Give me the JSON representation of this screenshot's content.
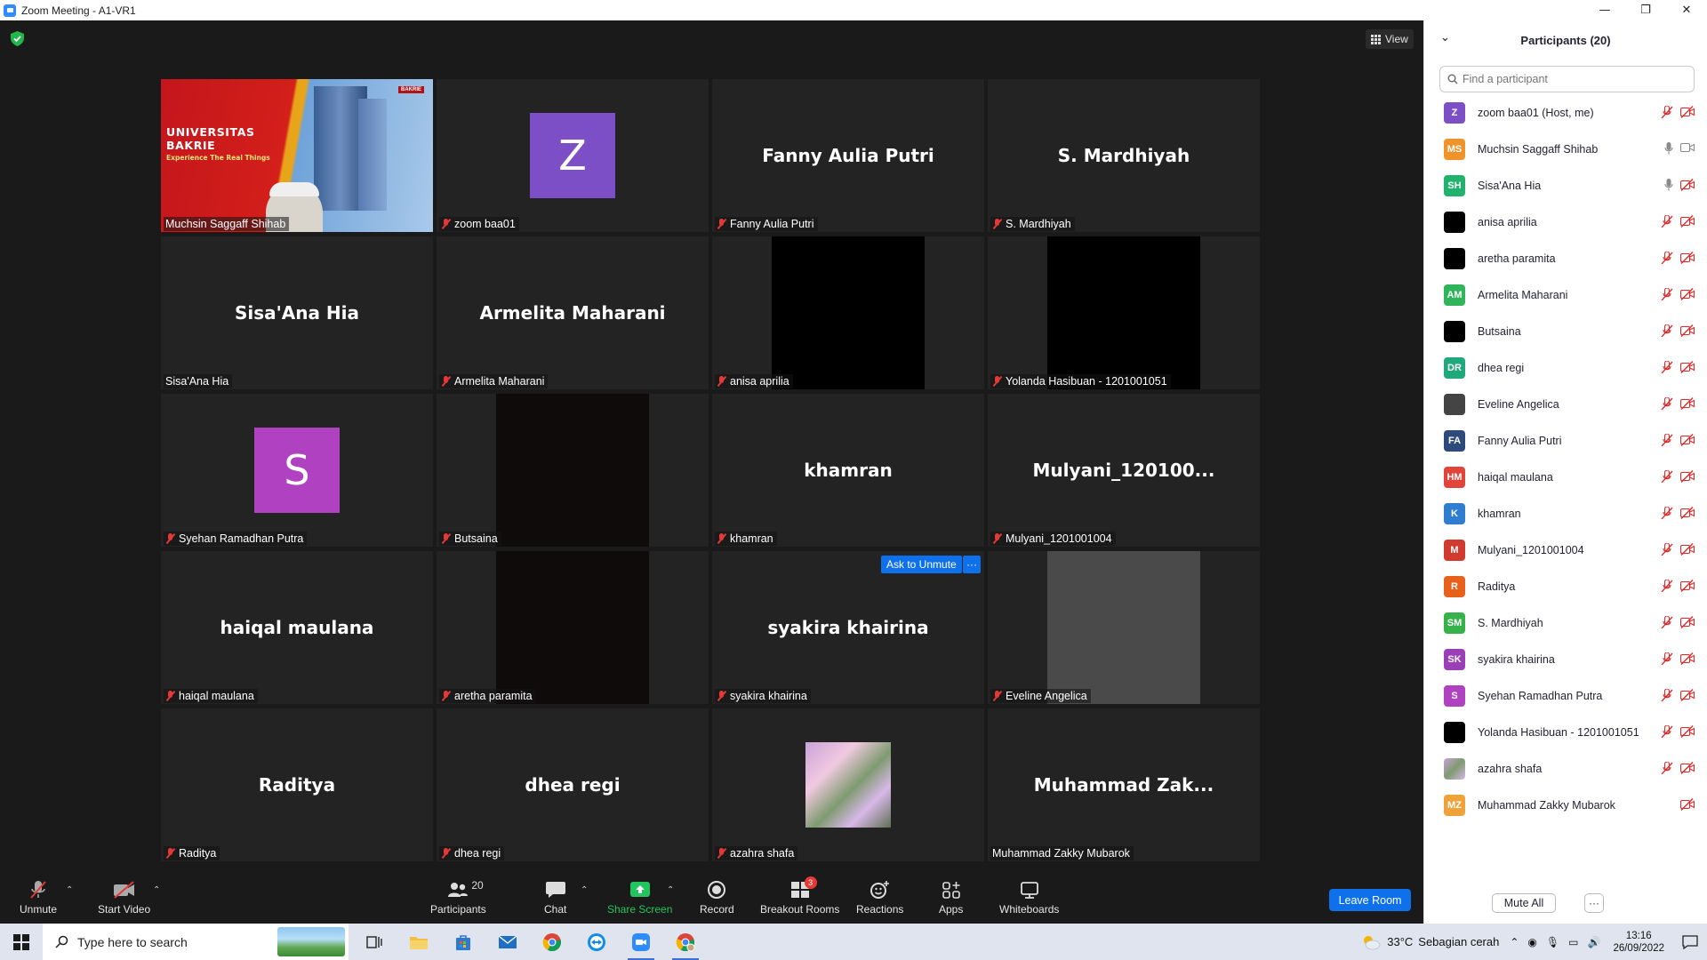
{
  "window": {
    "title": "Zoom Meeting - A1-VR1",
    "controls": [
      "—",
      "❐",
      "✕"
    ]
  },
  "meeting": {
    "view_label": "View",
    "tiles": [
      {
        "type": "video",
        "label": "Muchsin Saggaff Shihab",
        "muted": false,
        "active": true,
        "overlay": {
          "uni": "UNIVERSITAS BAKRIE",
          "tagline": "Experience The Real Things",
          "brand": "BAKRIE"
        }
      },
      {
        "type": "avatar",
        "letter": "Z",
        "color": "#7d4fc6",
        "label": "zoom baa01",
        "muted": true
      },
      {
        "type": "name",
        "display": "Fanny Aulia Putri",
        "label": "Fanny Aulia Putri",
        "muted": true
      },
      {
        "type": "name",
        "display": "S. Mardhiyah",
        "label": "S. Mardhiyah",
        "muted": true
      },
      {
        "type": "name",
        "display": "Sisa'Ana Hia",
        "label": "Sisa'Ana Hia",
        "muted": false
      },
      {
        "type": "name",
        "display": "Armelita Maharani",
        "label": "Armelita Maharani",
        "muted": true
      },
      {
        "type": "black",
        "label": "anisa aprilia",
        "muted": true
      },
      {
        "type": "black",
        "label": "Yolanda Hasibuan - 1201001051",
        "muted": true
      },
      {
        "type": "avatar",
        "letter": "S",
        "color": "#b042c2",
        "label": "Syehan Ramadhan Putra",
        "muted": true
      },
      {
        "type": "darkred",
        "label": "Butsaina",
        "muted": true
      },
      {
        "type": "name",
        "display": "khamran",
        "label": "khamran",
        "muted": true
      },
      {
        "type": "name",
        "display": "Mulyani_120100...",
        "label": "Mulyani_1201001004",
        "muted": true
      },
      {
        "type": "name",
        "display": "haiqal maulana",
        "label": "haiqal maulana",
        "muted": true
      },
      {
        "type": "darkred",
        "label": "aretha paramita",
        "muted": true
      },
      {
        "type": "name",
        "display": "syakira khairina",
        "label": "syakira khairina",
        "muted": true
      },
      {
        "type": "gray",
        "label": "Eveline Angelica",
        "muted": true
      },
      {
        "type": "name",
        "display": "Raditya",
        "label": "Raditya",
        "muted": true
      },
      {
        "type": "name",
        "display": "dhea regi",
        "label": "dhea regi",
        "muted": true
      },
      {
        "type": "photo",
        "label": "azahra shafa",
        "muted": true
      },
      {
        "type": "name",
        "display": "Muhammad  Zak...",
        "label": "Muhammad Zakky Mubarok",
        "muted": false
      }
    ],
    "ask_to_unmute": "Ask to Unmute",
    "ask_more": "···"
  },
  "toolbar": {
    "unmute": "Unmute",
    "start_video": "Start Video",
    "participants": "Participants",
    "participants_count": "20",
    "chat": "Chat",
    "share_screen": "Share Screen",
    "record": "Record",
    "breakout_rooms": "Breakout Rooms",
    "breakout_badge": "3",
    "reactions": "Reactions",
    "apps": "Apps",
    "whiteboards": "Whiteboards",
    "leave": "Leave Room",
    "caret": "⌃"
  },
  "panel": {
    "title": "Participants (20)",
    "search_placeholder": "Find a participant",
    "participants": [
      {
        "initials": "Z",
        "color": "#7d4fc6",
        "name": "zoom baa01 (Host, me)",
        "audio": "muted",
        "video": "off"
      },
      {
        "initials": "MS",
        "color": "#f0932b",
        "name": "Muchsin Saggaff Shihab",
        "audio": "on",
        "video": "on"
      },
      {
        "initials": "SH",
        "color": "#20b26c",
        "name": "Sisa'Ana Hia",
        "audio": "on",
        "video": "off"
      },
      {
        "initials": "",
        "color": "#000000",
        "name": "anisa aprilia",
        "audio": "muted",
        "video": "off"
      },
      {
        "initials": "",
        "color": "#000000",
        "name": "aretha paramita",
        "audio": "muted",
        "video": "off"
      },
      {
        "initials": "AM",
        "color": "#2fb45a",
        "name": "Armelita Maharani",
        "audio": "muted",
        "video": "off"
      },
      {
        "initials": "",
        "color": "#000000",
        "name": "Butsaina",
        "audio": "muted",
        "video": "off"
      },
      {
        "initials": "DR",
        "color": "#1fa87a",
        "name": "dhea regi",
        "audio": "muted",
        "video": "off"
      },
      {
        "initials": "",
        "color": "#444444",
        "name": "Eveline Angelica",
        "audio": "muted",
        "video": "off"
      },
      {
        "initials": "FA",
        "color": "#2d4a7a",
        "name": "Fanny Aulia Putri",
        "audio": "muted",
        "video": "off"
      },
      {
        "initials": "HM",
        "color": "#e0443a",
        "name": "haiqal maulana",
        "audio": "muted",
        "video": "off"
      },
      {
        "initials": "K",
        "color": "#2f7dd1",
        "name": "khamran",
        "audio": "muted",
        "video": "off"
      },
      {
        "initials": "M",
        "color": "#d13b2f",
        "name": "Mulyani_1201001004",
        "audio": "muted",
        "video": "off"
      },
      {
        "initials": "R",
        "color": "#e8611a",
        "name": "Raditya",
        "audio": "muted",
        "video": "off"
      },
      {
        "initials": "SM",
        "color": "#36b24a",
        "name": "S. Mardhiyah",
        "audio": "muted",
        "video": "off"
      },
      {
        "initials": "SK",
        "color": "#9b3fb8",
        "name": "syakira khairina",
        "audio": "muted",
        "video": "off"
      },
      {
        "initials": "S",
        "color": "#b042c2",
        "name": "Syehan Ramadhan Putra",
        "audio": "muted",
        "video": "off"
      },
      {
        "initials": "",
        "color": "#000000",
        "name": "Yolanda Hasibuan - 1201001051",
        "audio": "muted",
        "video": "off"
      },
      {
        "initials": "",
        "color": "#b98fc9",
        "name": "azahra shafa",
        "audio": "muted",
        "video": "off"
      },
      {
        "initials": "MZ",
        "color": "#f0a23a",
        "name": "Muhammad Zakky Mubarok",
        "audio": "none",
        "video": "off"
      }
    ],
    "mute_all": "Mute All",
    "more": "···"
  },
  "taskbar": {
    "search_placeholder": "Type here to search",
    "temperature": "33°C",
    "weather": "Sebagian cerah",
    "time": "13:16",
    "date": "26/09/2022"
  }
}
